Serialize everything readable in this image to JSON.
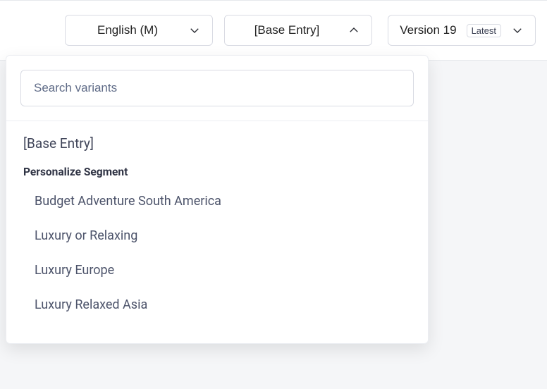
{
  "toolbar": {
    "language": {
      "label": "English (M)"
    },
    "variant": {
      "label": "[Base Entry]"
    },
    "version": {
      "label": "Version 19",
      "badge": "Latest"
    }
  },
  "dropdown": {
    "search_placeholder": "Search variants",
    "base_entry_label": "[Base Entry]",
    "group_header": "Personalize Segment",
    "items": [
      "Budget Adventure South America",
      "Luxury or Relaxing",
      "Luxury Europe",
      "Luxury Relaxed Asia"
    ]
  }
}
